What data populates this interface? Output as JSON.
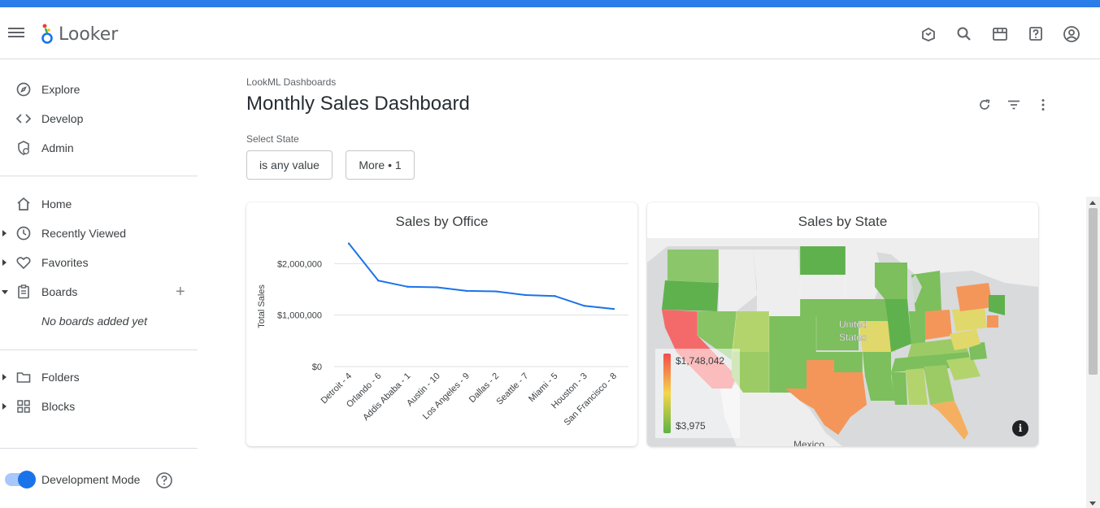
{
  "app": {
    "name": "Looker"
  },
  "sidebar": {
    "items": [
      {
        "label": "Explore",
        "icon": "compass-icon"
      },
      {
        "label": "Develop",
        "icon": "code-icon"
      },
      {
        "label": "Admin",
        "icon": "admin-icon"
      },
      {
        "label": "Home",
        "icon": "home-icon"
      },
      {
        "label": "Recently Viewed",
        "icon": "clock-icon"
      },
      {
        "label": "Favorites",
        "icon": "heart-icon"
      },
      {
        "label": "Boards",
        "icon": "clipboard-icon"
      },
      {
        "label": "Folders",
        "icon": "folder-icon"
      },
      {
        "label": "Blocks",
        "icon": "blocks-icon"
      }
    ],
    "boards_empty": "No boards added yet",
    "dev_mode_label": "Development Mode",
    "dev_mode_on": true
  },
  "dashboard": {
    "breadcrumb": "LookML Dashboards",
    "title": "Monthly Sales Dashboard",
    "filter_label": "Select State",
    "filter_value": "is any value",
    "more_filters": "More • 1"
  },
  "tiles": {
    "office": {
      "title": "Sales by Office"
    },
    "state": {
      "title": "Sales by State",
      "map_label": "United\nStates",
      "map_label_line1": "United",
      "map_label_line2": "States",
      "map_label_bottom": "Mexico",
      "legend_max": "$1,748,042",
      "legend_min": "$3,975",
      "colors": {
        "high": "#f44b4b",
        "mid": "#f4d64b",
        "low": "#5db345"
      }
    }
  },
  "chart_data": {
    "type": "line",
    "title": "Sales by Office",
    "xlabel": "",
    "ylabel": "Total Sales",
    "categories": [
      "Detroit - 4",
      "Orlando - 6",
      "Addis Ababa - 1",
      "Austin - 10",
      "Los Angeles - 9",
      "Dallas - 2",
      "Seattle - 7",
      "Miami - 5",
      "Houston - 3",
      "San Francisco - 8"
    ],
    "values": [
      2390000,
      1670000,
      1550000,
      1540000,
      1470000,
      1460000,
      1390000,
      1370000,
      1180000,
      1120000
    ],
    "yticks": [
      "$0",
      "$1,000,000",
      "$2,000,000"
    ],
    "ytick_values": [
      0,
      1000000,
      2000000
    ],
    "ylim": [
      0,
      2400000
    ],
    "grid": true,
    "color": "#1a73e8"
  },
  "colors": {
    "accent": "#1a73e8",
    "topstrip": "#2b7de9"
  }
}
